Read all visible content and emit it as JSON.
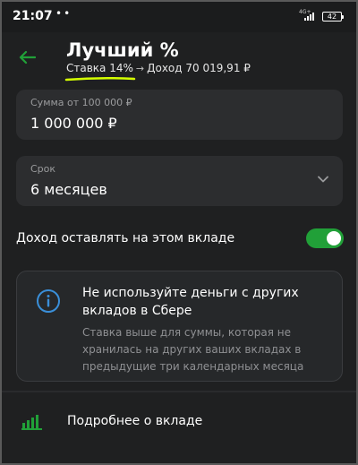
{
  "status_bar": {
    "time": "21:07",
    "dots": "••",
    "network": "4G+",
    "battery": "42"
  },
  "header": {
    "title": "Лучший %",
    "rate_text": "Ставка 14%",
    "arrow": "→",
    "income_text": "Доход 70 019,91 ₽"
  },
  "amount_field": {
    "label": "Сумма от 100 000 ₽",
    "value": "1 000 000 ₽"
  },
  "term_field": {
    "label": "Срок",
    "value": "6 месяцев"
  },
  "income_toggle": {
    "label": "Доход оставлять на этом вкладе",
    "enabled": true
  },
  "info_card": {
    "title": "Не используйте деньги с других вкладов в Сбере",
    "text": "Ставка выше для суммы, которая не хранилась на других ваших вкладах в предыдущие три календарных месяца"
  },
  "details_link": {
    "label": "Подробнее о вкладе"
  },
  "colors": {
    "accent_green": "#21a038",
    "highlight_yellow": "#d4ff00",
    "info_blue": "#3a8fd9"
  }
}
